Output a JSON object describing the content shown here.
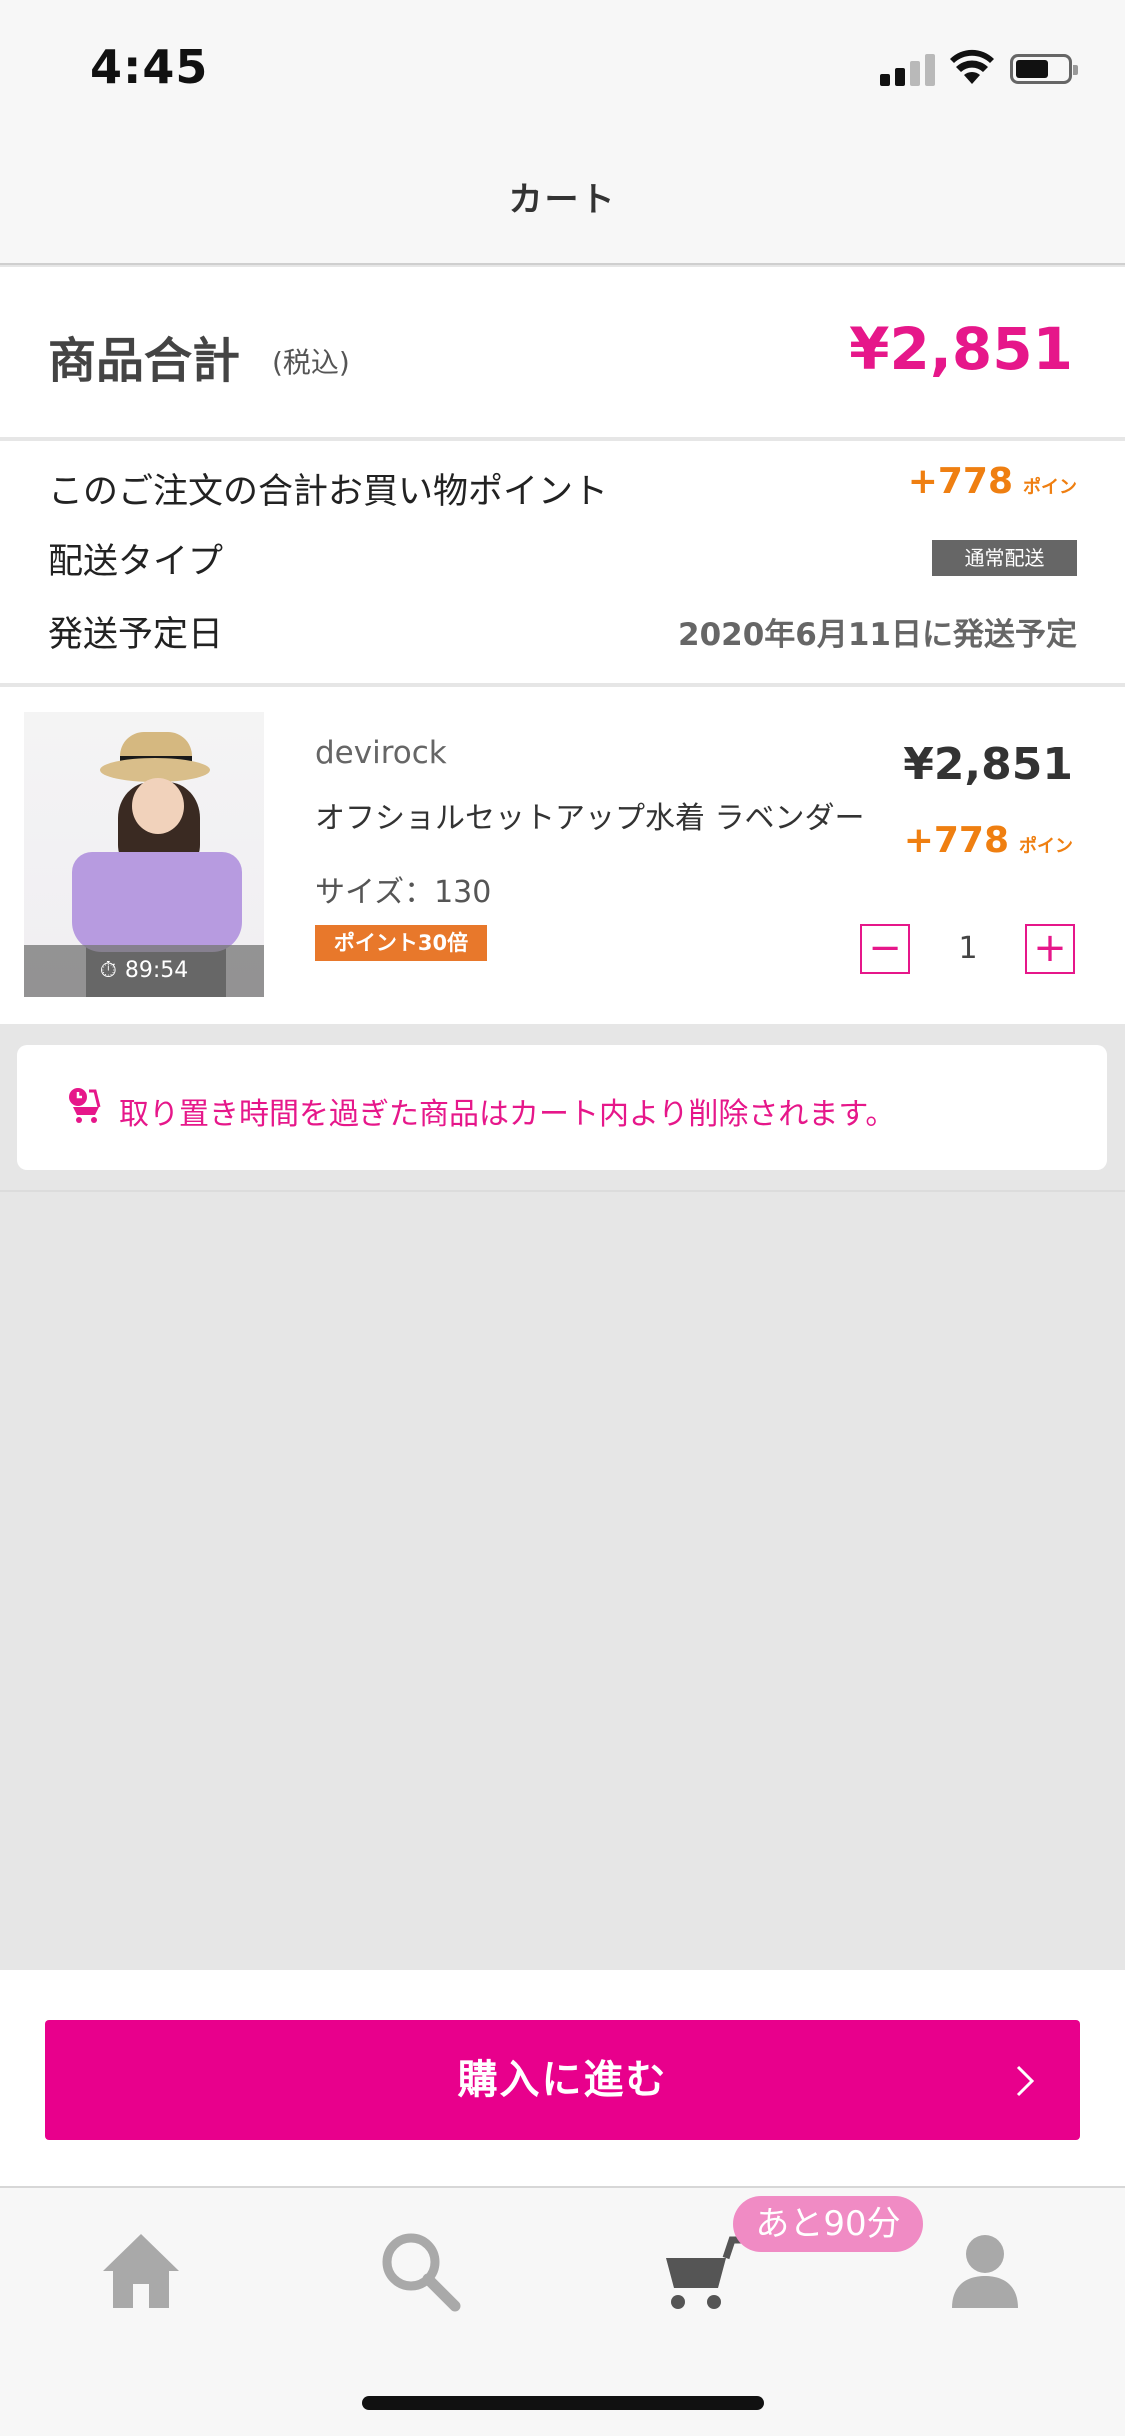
{
  "status_bar": {
    "time": "4:45"
  },
  "nav": {
    "title": "カート"
  },
  "summary": {
    "total_label": "商品合計",
    "tax_label": "(税込)",
    "total_price": "¥2,851"
  },
  "order_info": {
    "points_label": "このご注文の合計お買い物ポイント",
    "points_value": "+778",
    "points_unit": "ポイン",
    "shipping_type_label": "配送タイプ",
    "shipping_type_value": "通常配送",
    "ship_date_label": "発送予定日",
    "ship_date_value": "2020年6月11日に発送予定"
  },
  "cart_item": {
    "brand": "devirock",
    "name": "オフショルセットアップ水着 ラベンダー",
    "size": "サイズ：130",
    "badge": "ポイント30倍",
    "price": "¥2,851",
    "points": "+778",
    "points_unit": "ポイン",
    "quantity": "1",
    "hold_timer": "89:54",
    "minus_symbol": "−",
    "plus_symbol": "+"
  },
  "notice": {
    "text": "取り置き時間を過ぎた商品はカート内より削除されます。"
  },
  "checkout": {
    "label": "購入に進む"
  },
  "tab_bar": {
    "cart_badge": "あと90分",
    "items": [
      {
        "name": "home",
        "icon": "home-icon"
      },
      {
        "name": "search",
        "icon": "search-icon"
      },
      {
        "name": "cart",
        "icon": "cart-icon"
      },
      {
        "name": "account",
        "icon": "person-icon"
      }
    ]
  },
  "colors": {
    "accent": "#e8008c",
    "price_pink": "#e6178a",
    "points_orange": "#ef7f11",
    "badge_orange": "#e8782b",
    "badge_gray": "#666666",
    "cart_badge_pink": "#f08bc4"
  }
}
